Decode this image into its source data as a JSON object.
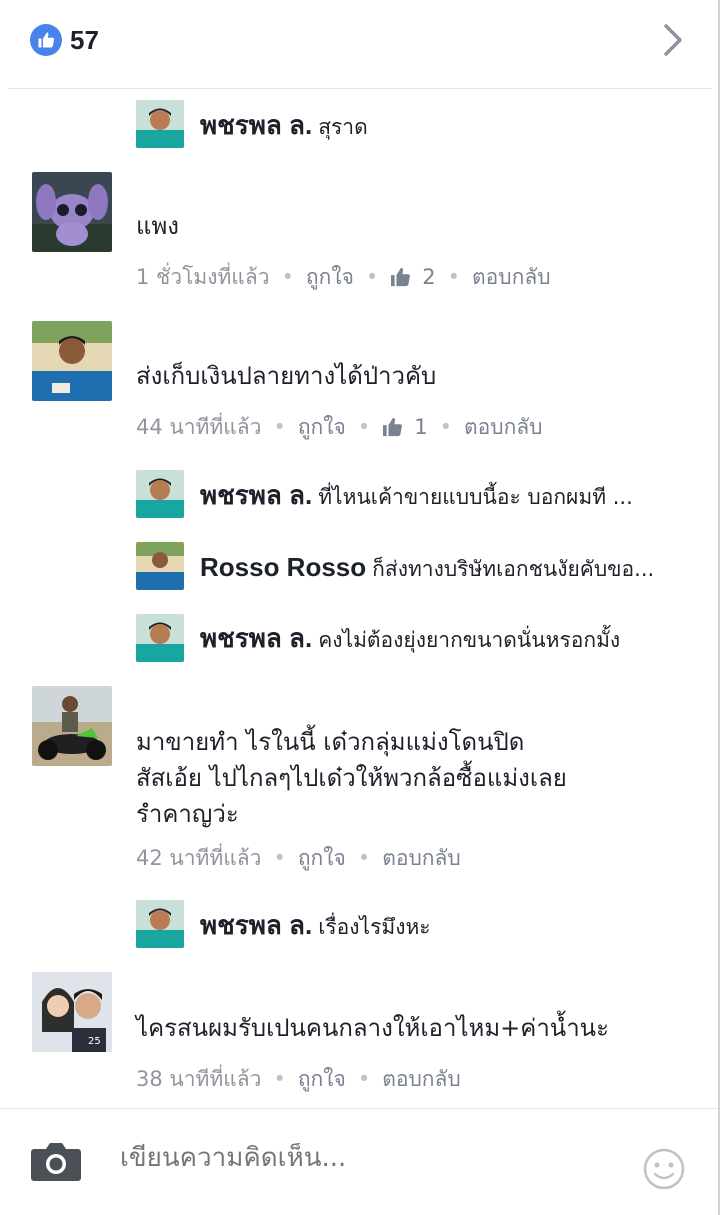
{
  "header": {
    "like_count": "57",
    "icons": {
      "like": "thumbs-up-icon",
      "next": "chevron-right-icon"
    }
  },
  "colors": {
    "like_blue": "#4a82ec",
    "meta_gray": "#90949c",
    "text": "#1d2129"
  },
  "threads": [
    {
      "type": "reply",
      "name": "พชรพล ล.",
      "text": "สุราด"
    },
    {
      "type": "comment",
      "text": "แพง",
      "time": "1 ชั่วโมงที่แล้ว",
      "like": "ถูกใจ",
      "likes": "2",
      "reply": "ตอบกลับ"
    },
    {
      "type": "comment",
      "text": "ส่งเก็บเงินปลายทางได้ป่าวคับ",
      "time": "44 นาทีที่แล้ว",
      "like": "ถูกใจ",
      "likes": "1",
      "reply": "ตอบกลับ"
    },
    {
      "type": "reply",
      "name": "พชรพล ล.",
      "text": "ที่ไหนเค้าขายแบบนี้อะ บอกผมที ..."
    },
    {
      "type": "reply",
      "name": "Rosso Rosso",
      "text": "ก็ส่งทางบริษัทเอกชนงัยคับขอ..."
    },
    {
      "type": "reply",
      "name": "พชรพล ล.",
      "text": "คงไม่ต้องยุ่งยากขนาดนั่นหรอกมั้ง"
    },
    {
      "type": "comment",
      "lines": [
        "มาขายทำ    ไรในนี้ เด๋วกลุ่มแม่งโดนปิด",
        "สัสเอ้ย ไปไกลๆไปเด๋วให้พวกล้อซื้อแม่งเลย",
        "รำคาญว่ะ"
      ],
      "time": "42 นาทีที่แล้ว",
      "like": "ถูกใจ",
      "reply": "ตอบกลับ"
    },
    {
      "type": "reply",
      "name": "พชรพล ล.",
      "text": "เรื่องไรมึงหะ"
    },
    {
      "type": "comment",
      "text": "ไครสนผมรับเปนคนกลางให้เอาไหม+ค่าน้ำนะ",
      "time": "38 นาทีที่แล้ว",
      "like": "ถูกใจ",
      "reply": "ตอบกลับ"
    }
  ],
  "composer": {
    "placeholder": "เขียนความคิดเห็น...",
    "icons": {
      "camera": "camera-icon",
      "emoji": "smiley-icon"
    }
  }
}
